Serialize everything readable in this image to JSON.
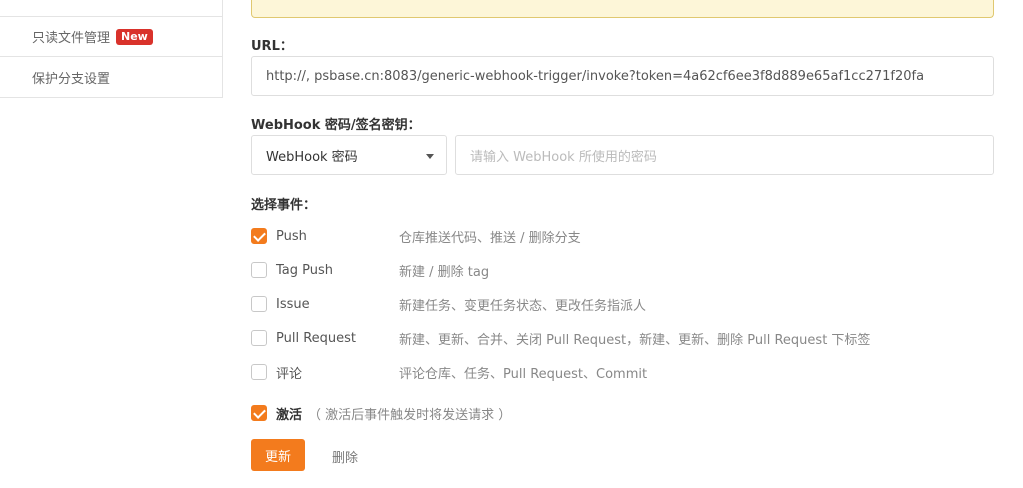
{
  "sidebar": {
    "items": [
      {
        "label": "只读文件管理",
        "badge": "New"
      },
      {
        "label": "保护分支设置"
      }
    ]
  },
  "form": {
    "url_label": "URL：",
    "url_value": "http://,  psbase.cn:8083/generic-webhook-trigger/invoke?token=4a62cf6ee3f8d889e65af1cc271f20fa",
    "secret_label": "WebHook 密码/签名密钥：",
    "secret_type_selected": "WebHook 密码",
    "secret_placeholder": "请输入 WebHook 所使用的密码",
    "events_label": "选择事件：",
    "events": [
      {
        "name": "Push",
        "desc": "仓库推送代码、推送 / 删除分支",
        "checked": true
      },
      {
        "name": "Tag Push",
        "desc": "新建 / 删除 tag",
        "checked": false
      },
      {
        "name": "Issue",
        "desc": "新建任务、变更任务状态、更改任务指派人",
        "checked": false
      },
      {
        "name": "Pull Request",
        "desc": "新建、更新、合并、关闭 Pull Request，新建、更新、删除 Pull Request 下标签",
        "checked": false
      },
      {
        "name": "评论",
        "desc": "评论仓库、任务、Pull Request、Commit",
        "checked": false
      }
    ],
    "active_label": "激活",
    "active_hint": "（ 激活后事件触发时将发送请求 ）",
    "active_checked": true,
    "update_button": "更新",
    "delete_button": "删除"
  },
  "colors": {
    "accent": "#f37b1d",
    "badge": "#d9322b"
  }
}
